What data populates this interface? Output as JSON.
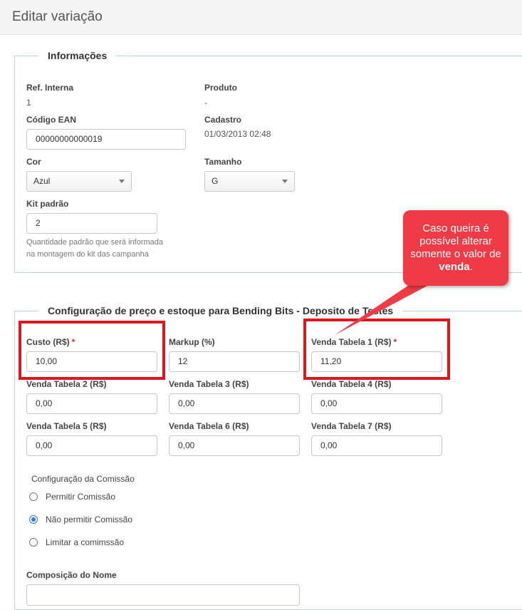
{
  "page": {
    "title": "Editar variação"
  },
  "info": {
    "legend": "Informações",
    "ref_interna_label": "Ref. Interna",
    "ref_interna_value": "1",
    "produto_label": "Produto",
    "produto_value": "-",
    "ean_label": "Código EAN",
    "ean_value": "00000000000019",
    "cadastro_label": "Cadastro",
    "cadastro_value": "01/03/2013 02:48",
    "cor_label": "Cor",
    "cor_value": "Azul",
    "tamanho_label": "Tamanho",
    "tamanho_value": "G",
    "kit_label": "Kit padrão",
    "kit_value": "2",
    "kit_help_1": "Quantidade padrão que será informada",
    "kit_help_2": "na montagem do kit das campanha"
  },
  "pricing": {
    "legend": "Configuração de preço e estoque para Bending Bits - Deposito de Testes",
    "required_mark": "*",
    "custo_label": "Custo (R$)",
    "custo_value": "10,00",
    "markup_label": "Markup (%)",
    "markup_value": "12",
    "venda1_label": "Venda Tabela 1 (R$)",
    "venda1_value": "11,20",
    "venda2_label": "Venda Tabela 2 (R$)",
    "venda2_value": "0,00",
    "venda3_label": "Venda Tabela 3 (R$)",
    "venda3_value": "0,00",
    "venda4_label": "Venda Tabela 4 (R$)",
    "venda4_value": "0,00",
    "venda5_label": "Venda Tabela 5 (R$)",
    "venda5_value": "0,00",
    "venda6_label": "Venda Tabela 6 (R$)",
    "venda6_value": "0,00",
    "venda7_label": "Venda Tabela 7 (R$)",
    "venda7_value": "0,00"
  },
  "commission": {
    "title": "Configuração da Comissão",
    "options": [
      {
        "label": "Permitir Comissão",
        "checked": false
      },
      {
        "label": "Não permitir Comissão",
        "checked": true
      },
      {
        "label": "Limitar a comimssão",
        "checked": false
      }
    ]
  },
  "composition": {
    "label": "Composição do Nome",
    "value": ""
  },
  "callout": {
    "line1": "Caso queira é",
    "line2": "possível alterar",
    "line3": "somente o valor de",
    "bold": "venda",
    "tail": "."
  },
  "colors": {
    "highlight": "#e0161e",
    "callout": "#f03a45",
    "accent": "#2a7ae2"
  }
}
